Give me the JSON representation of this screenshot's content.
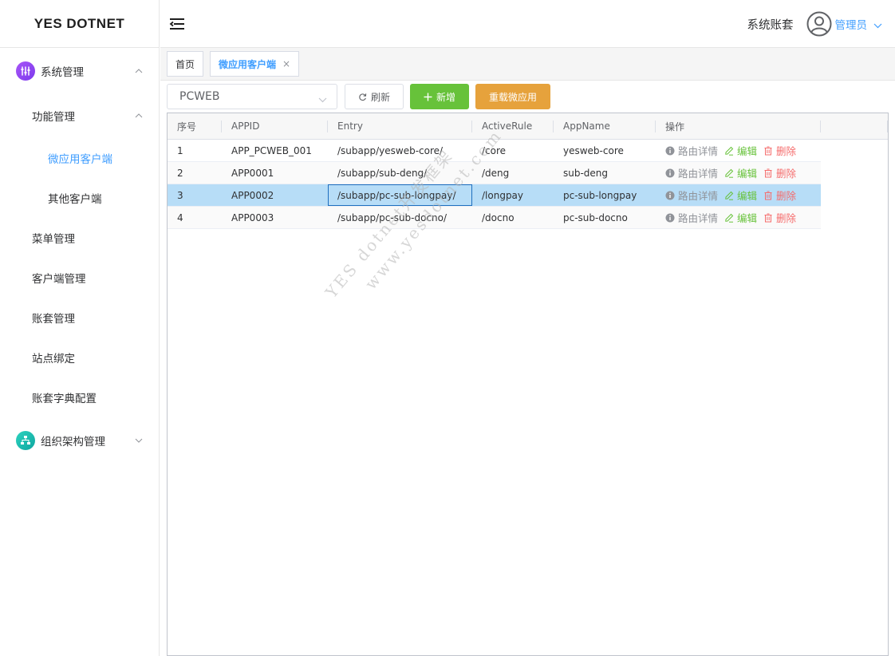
{
  "app": {
    "brand": "YES DOTNET"
  },
  "header": {
    "account_label": "系统账套",
    "user_name": "管理员"
  },
  "sidebar": {
    "groups": [
      {
        "label": "系统管理",
        "icon": "sliders-icon",
        "expanded": true
      },
      {
        "label": "组织架构管理",
        "icon": "org-chart-icon",
        "expanded": false
      }
    ],
    "items": [
      {
        "label": "功能管理"
      },
      {
        "label": "微应用客户端"
      },
      {
        "label": "其他客户端"
      },
      {
        "label": "菜单管理"
      },
      {
        "label": "客户端管理"
      },
      {
        "label": "账套管理"
      },
      {
        "label": "站点绑定"
      },
      {
        "label": "账套字典配置"
      }
    ]
  },
  "tabs": [
    {
      "label": "首页"
    },
    {
      "label": "微应用客户端",
      "close": "×"
    }
  ],
  "toolbar": {
    "select_value": "PCWEB",
    "refresh_label": "刷新",
    "add_label": "新增",
    "reload_label": "重载微应用"
  },
  "table": {
    "headers": [
      "序号",
      "APPID",
      "Entry",
      "ActiveRule",
      "AppName",
      "操作"
    ],
    "rows": [
      {
        "idx": "1",
        "appid": "APP_PCWEB_001",
        "entry": "/subapp/yesweb-core/",
        "rule": "/core",
        "name": "yesweb-core"
      },
      {
        "idx": "2",
        "appid": "APP0001",
        "entry": "/subapp/sub-deng/",
        "rule": "/deng",
        "name": "sub-deng"
      },
      {
        "idx": "3",
        "appid": "APP0002",
        "entry": "/subapp/pc-sub-longpay/",
        "rule": "/longpay",
        "name": "pc-sub-longpay"
      },
      {
        "idx": "4",
        "appid": "APP0003",
        "entry": "/subapp/pc-sub-docno/",
        "rule": "/docno",
        "name": "pc-sub-docno"
      }
    ],
    "actions": {
      "detail": "路由详情",
      "edit": "编辑",
      "delete": "删除"
    }
  },
  "watermark": {
    "line1": "YES dotnet开发框架",
    "line2": "www.yesdotnet.com"
  },
  "colors": {
    "primary": "#409eff",
    "success": "#67c23a",
    "warning": "#e6a23c",
    "danger": "#f56c6c",
    "selected_row": "#b7ddf7"
  }
}
